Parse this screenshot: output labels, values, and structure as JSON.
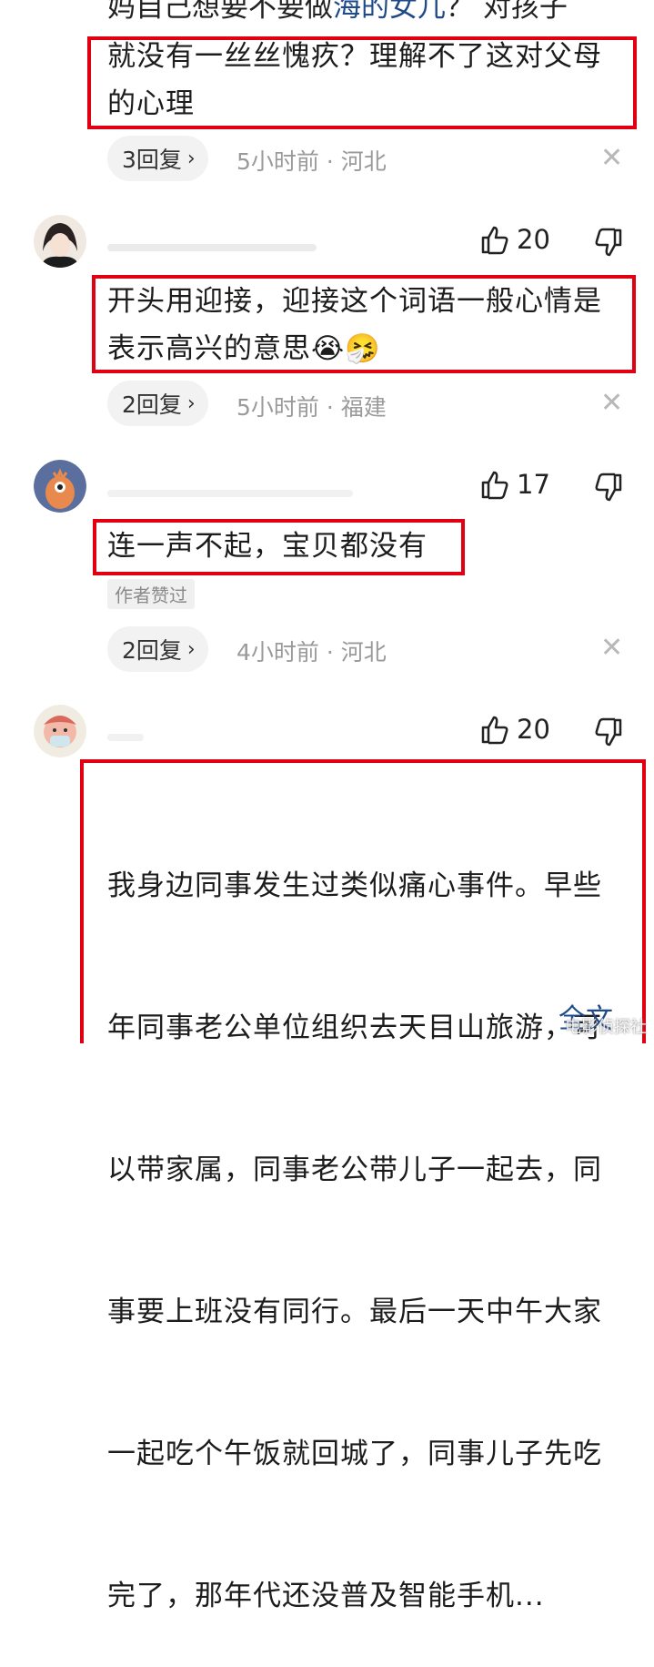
{
  "comments": [
    {
      "top_cut_text": "妈自己想要不要做",
      "top_cut_link": "海的女儿",
      "top_cut_tail": "？ 对孩子",
      "text_lines": [
        "就没有一丝丝愧疚？理解不了这对父母",
        "的心理"
      ],
      "replies": "3回复",
      "meta": "5小时前 · 河北"
    },
    {
      "likes": "20",
      "text_lines": [
        "开头用迎接，迎接这个词语一般心情是",
        "表示高兴的意思😭🤧"
      ],
      "replies": "2回复",
      "meta": "5小时前 · 福建"
    },
    {
      "likes": "17",
      "text_lines": [
        "连一声不起，宝贝都没有"
      ],
      "tag": "作者赞过",
      "replies": "2回复",
      "meta": "4小时前 · 河北"
    },
    {
      "likes": "20",
      "text_lines": [
        "我身边同事发生过类似痛心事件。早些",
        "年同事老公单位组织去天目山旅游，可",
        "以带家属，同事老公带儿子一起去，同",
        "事要上班没有同行。最后一天中午大家",
        "一起吃个午饭就回城了，同事儿子先吃",
        "完了，那年代还没普及智能手机..."
      ],
      "full_text": "全文"
    }
  ],
  "chevron": "›",
  "close_glyph": "✕",
  "watermark": "电影侦探社",
  "colors": {
    "highlight_border": "#e00012",
    "link": "#1f4a8a"
  }
}
